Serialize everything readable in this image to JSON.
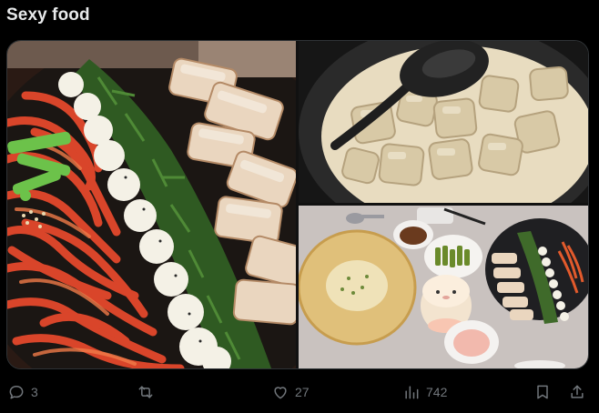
{
  "tweet": {
    "text": "Sexy food"
  },
  "media": [
    {
      "alt": ""
    },
    {
      "alt": ""
    },
    {
      "alt": ""
    }
  ],
  "actions": {
    "reply_count": "3",
    "retweet_count": "",
    "like_count": "27",
    "view_count": "742"
  },
  "icons": {
    "reply": "reply-icon",
    "retweet": "retweet-icon",
    "like": "heart-icon",
    "views": "views-icon",
    "bookmark": "bookmark-icon",
    "share": "share-icon"
  },
  "colors": {
    "background": "#000000",
    "text": "#e7e9ea",
    "muted": "#71767b"
  }
}
